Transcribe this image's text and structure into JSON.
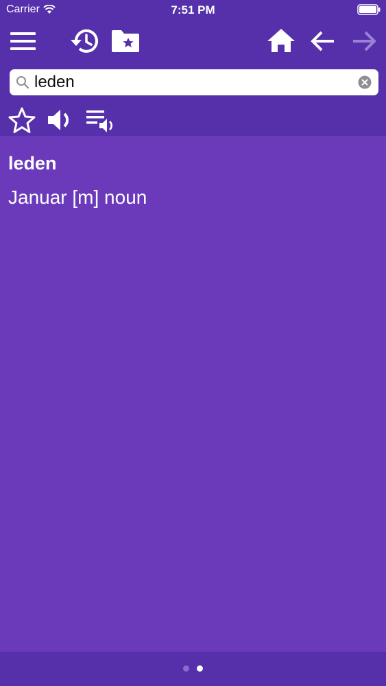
{
  "status_bar": {
    "carrier": "Carrier",
    "time": "7:51 PM"
  },
  "toolbar": {
    "icons": [
      "menu-icon",
      "history-icon",
      "favorites-folder-icon",
      "home-icon",
      "back-arrow-icon",
      "forward-arrow-icon"
    ]
  },
  "search": {
    "value": "leden",
    "placeholder": ""
  },
  "actions": {
    "icons": [
      "star-icon",
      "speaker-icon",
      "play-list-icon"
    ]
  },
  "entry": {
    "headword": "leden",
    "definition": "Januar [m] noun"
  },
  "pager": {
    "current_page": 2,
    "total_pages": 2
  },
  "colors": {
    "bar": "#5530aa",
    "background": "#6a3abb",
    "text": "#ffffff",
    "disabled": "#9a82d6"
  }
}
